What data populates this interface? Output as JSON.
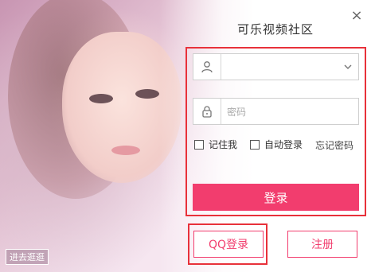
{
  "window": {
    "title": "可乐视频社区",
    "close_glyph": "×"
  },
  "login_form": {
    "username_placeholder": "",
    "password_placeholder": "密码",
    "remember_label": "记住我",
    "auto_login_label": "自动登录",
    "forgot_password_label": "忘记密码",
    "login_button_label": "登录"
  },
  "footer": {
    "qq_login_label": "QQ登录",
    "register_label": "注册",
    "tour_label": "进去逛逛"
  },
  "colors": {
    "accent": "#f23d6e",
    "highlight_border": "#e8313a"
  },
  "icons": {
    "user": "user-icon",
    "lock": "lock-icon",
    "dropdown": "chevron-down-icon"
  }
}
